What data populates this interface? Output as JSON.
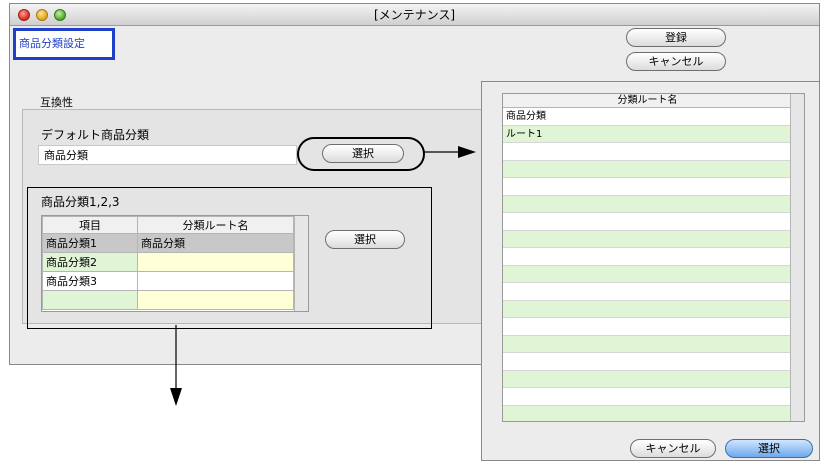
{
  "window": {
    "title": "[メンテナンス]"
  },
  "header": {
    "badge": "商品分類設定",
    "register_label": "登録",
    "cancel_label": "キャンセル"
  },
  "section": {
    "label": "互換性"
  },
  "default": {
    "label": "デフォルト商品分類",
    "value": "商品分類",
    "select_label": "選択"
  },
  "group": {
    "label": "商品分類1,2,3",
    "columns": [
      "項目",
      "分類ルート名"
    ],
    "rows": [
      [
        "商品分類1",
        "商品分類"
      ],
      [
        "商品分類2",
        ""
      ],
      [
        "商品分類3",
        ""
      ],
      [
        "",
        ""
      ]
    ],
    "select_label": "選択"
  },
  "picker": {
    "column": "分類ルート名",
    "rows": [
      "商品分類",
      "ルート1"
    ],
    "cancel_label": "キャンセル",
    "select_label": "選択"
  }
}
